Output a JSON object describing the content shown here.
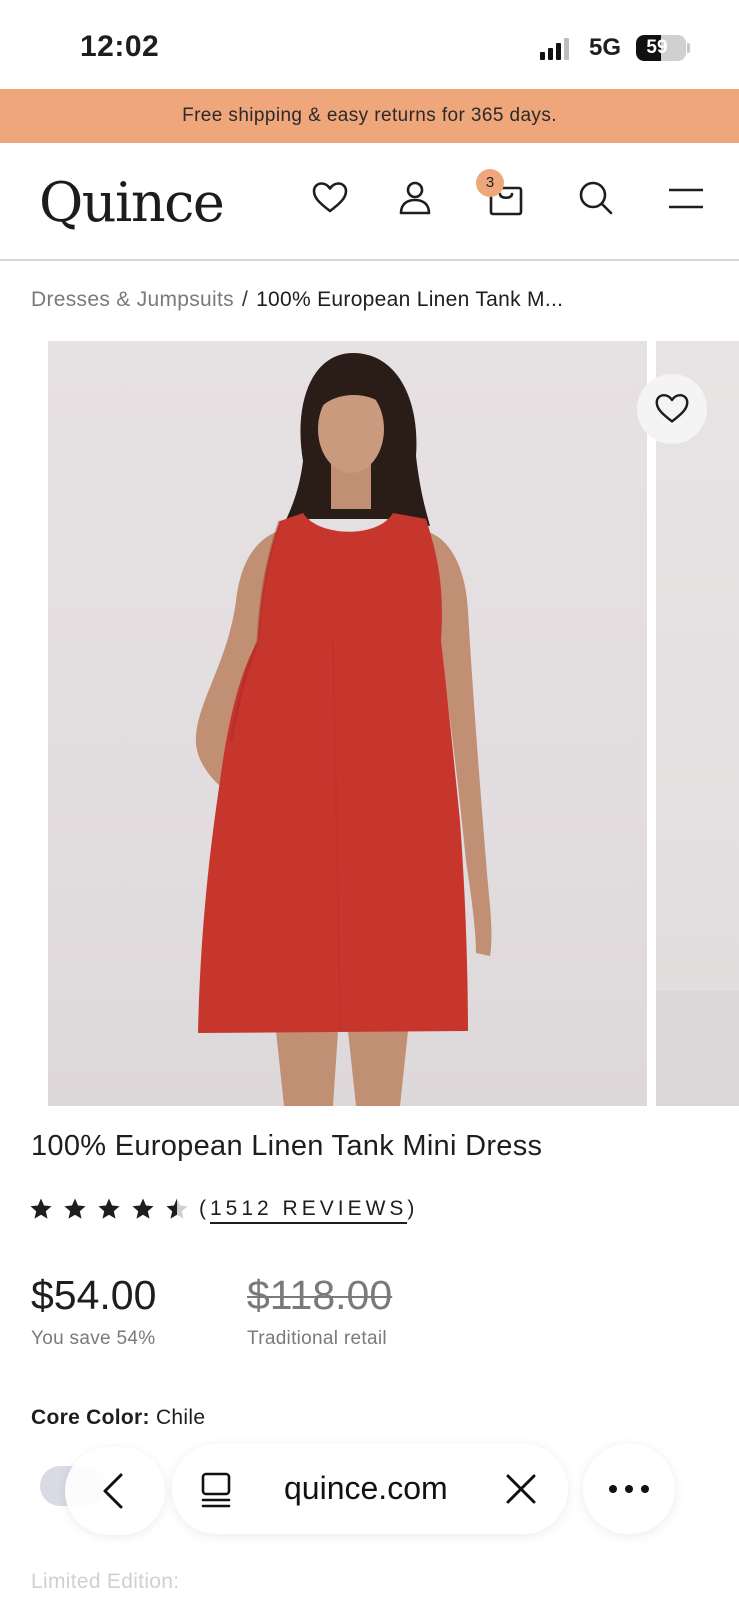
{
  "status_bar": {
    "time": "12:02",
    "network": "5G",
    "battery_percent": "59",
    "signal_bars": 3
  },
  "promo_banner": {
    "text": "Free shipping & easy returns for 365 days."
  },
  "header": {
    "logo": "Quince",
    "cart_count": "3",
    "icons": [
      "heart-icon",
      "account-icon",
      "bag-icon",
      "search-icon",
      "menu-icon"
    ]
  },
  "breadcrumb": {
    "parent": "Dresses & Jumpsuits",
    "separator": "/",
    "current": "100% European Linen Tank M..."
  },
  "product": {
    "title": "100% European Linen Tank Mini Dress",
    "rating": 4.5,
    "reviews_label": "(1512 REVIEWS)",
    "reviews_count": "1512 REVIEWS",
    "price": "$54.00",
    "savings": "You save 54%",
    "retail_price": "$118.00",
    "retail_label": "Traditional retail",
    "color_label": "Core Color:",
    "color_value": "Chile",
    "limited_label": "Limited Edition:",
    "dress_color": "#c7362d"
  },
  "browser": {
    "domain": "quince.com"
  },
  "colors": {
    "promo": "#f0a67b",
    "text": "#1e1e1e",
    "muted": "#7a7a7a"
  }
}
